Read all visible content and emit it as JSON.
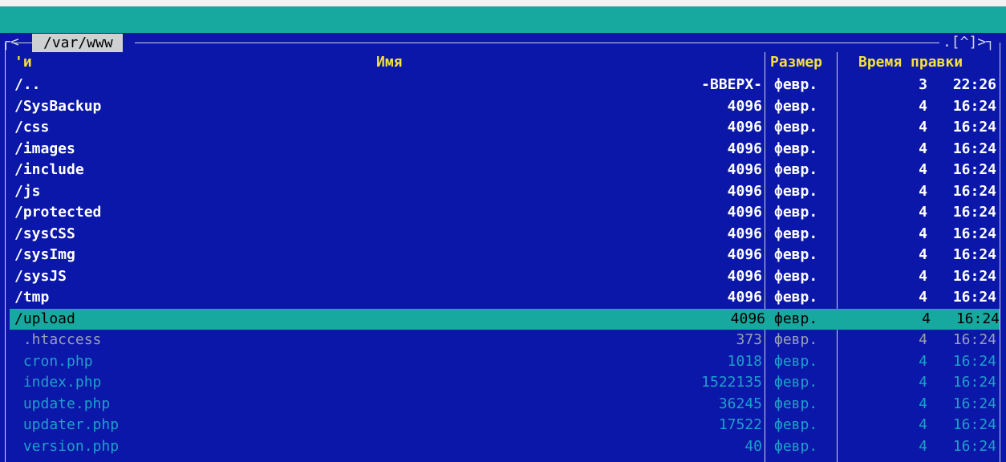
{
  "panel": {
    "path": "/var/www",
    "corner_left": "┌<",
    "controls": ".[^]>┐"
  },
  "header": {
    "sort_indicator": "'и",
    "name": "Имя",
    "size": "Размер",
    "time": "Время правки"
  },
  "files": [
    {
      "name": "/..",
      "size": "-ВВЕРХ-",
      "month": "февр.",
      "day": "3",
      "time": "22:26",
      "kind": "dir"
    },
    {
      "name": "/SysBackup",
      "size": "4096",
      "month": "февр.",
      "day": "4",
      "time": "16:24",
      "kind": "dir"
    },
    {
      "name": "/css",
      "size": "4096",
      "month": "февр.",
      "day": "4",
      "time": "16:24",
      "kind": "dir"
    },
    {
      "name": "/images",
      "size": "4096",
      "month": "февр.",
      "day": "4",
      "time": "16:24",
      "kind": "dir"
    },
    {
      "name": "/include",
      "size": "4096",
      "month": "февр.",
      "day": "4",
      "time": "16:24",
      "kind": "dir"
    },
    {
      "name": "/js",
      "size": "4096",
      "month": "февр.",
      "day": "4",
      "time": "16:24",
      "kind": "dir"
    },
    {
      "name": "/protected",
      "size": "4096",
      "month": "февр.",
      "day": "4",
      "time": "16:24",
      "kind": "dir"
    },
    {
      "name": "/sysCSS",
      "size": "4096",
      "month": "февр.",
      "day": "4",
      "time": "16:24",
      "kind": "dir"
    },
    {
      "name": "/sysImg",
      "size": "4096",
      "month": "февр.",
      "day": "4",
      "time": "16:24",
      "kind": "dir"
    },
    {
      "name": "/sysJS",
      "size": "4096",
      "month": "февр.",
      "day": "4",
      "time": "16:24",
      "kind": "dir"
    },
    {
      "name": "/tmp",
      "size": "4096",
      "month": "февр.",
      "day": "4",
      "time": "16:24",
      "kind": "dir"
    },
    {
      "name": "/upload",
      "size": "4096",
      "month": "февр.",
      "day": "4",
      "time": "16:24",
      "kind": "dir",
      "selected": true
    },
    {
      "name": " .htaccess",
      "size": "373",
      "month": "февр.",
      "day": "4",
      "time": "16:24",
      "kind": "hidden"
    },
    {
      "name": " cron.php",
      "size": "1018",
      "month": "февр.",
      "day": "4",
      "time": "16:24",
      "kind": "php"
    },
    {
      "name": " index.php",
      "size": "1522135",
      "month": "февр.",
      "day": "4",
      "time": "16:24",
      "kind": "php"
    },
    {
      "name": " update.php",
      "size": "36245",
      "month": "февр.",
      "day": "4",
      "time": "16:24",
      "kind": "php"
    },
    {
      "name": " updater.php",
      "size": "17522",
      "month": "февр.",
      "day": "4",
      "time": "16:24",
      "kind": "php"
    },
    {
      "name": " version.php",
      "size": "40",
      "month": "февр.",
      "day": "4",
      "time": "16:24",
      "kind": "php"
    }
  ],
  "colors": {
    "panel_bg": "#0a17a8",
    "menubar": "#17a8a0",
    "selection": "#17a8a0",
    "header_text": "#f4e13a",
    "dir_text": "#ffffff",
    "php_text": "#1fa0c9"
  }
}
